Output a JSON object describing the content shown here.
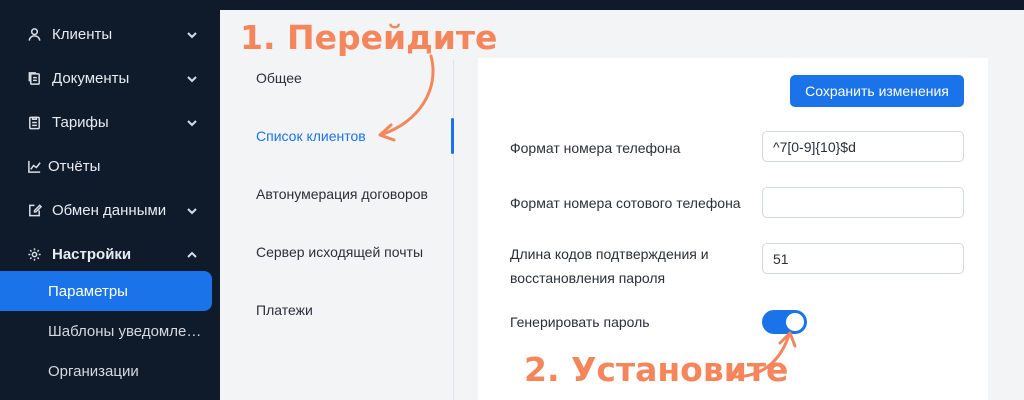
{
  "sidebar": {
    "items": [
      {
        "label": "Клиенты",
        "icon": "user-icon"
      },
      {
        "label": "Документы",
        "icon": "documents-icon"
      },
      {
        "label": "Тарифы",
        "icon": "clipboard-icon"
      },
      {
        "label": "Отчёты",
        "icon": "chart-line-icon"
      },
      {
        "label": "Обмен данными",
        "icon": "edit-icon"
      },
      {
        "label": "Настройки",
        "icon": "gear-icon"
      }
    ],
    "subitems": [
      {
        "label": "Параметры",
        "active": true
      },
      {
        "label": "Шаблоны уведомлений"
      },
      {
        "label": "Организации"
      }
    ]
  },
  "settings_nav": {
    "items": [
      {
        "label": "Общее"
      },
      {
        "label": "Список клиентов",
        "active": true
      },
      {
        "label": "Автонумерация договоров"
      },
      {
        "label": "Сервер исходящей почты"
      },
      {
        "label": "Платежи"
      }
    ]
  },
  "content": {
    "save_label": "Сохранить изменения",
    "fields": [
      {
        "label": "Формат номера телефона",
        "value": "^7[0-9]{10}$d"
      },
      {
        "label": "Формат номера сотового телефона",
        "value": ""
      },
      {
        "label_line1": "Длина кодов подтверждения и",
        "label_line2": "восстановления пароля",
        "value": "51"
      }
    ],
    "toggle": {
      "label": "Генерировать пароль",
      "on": true
    }
  },
  "annotations": {
    "step1": "1. Перейдите",
    "step2": "2. Установите",
    "color": "#f5855b"
  },
  "colors": {
    "accent": "#1a73e8",
    "sidebar_bg": "#0f1a2b"
  }
}
